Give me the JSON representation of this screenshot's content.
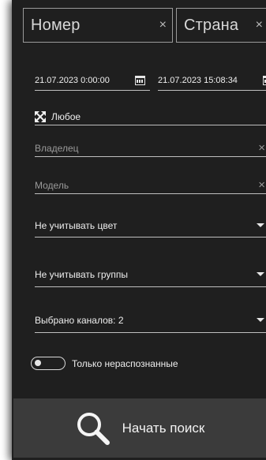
{
  "plate": {
    "placeholder": "Номер",
    "clear": "×"
  },
  "country": {
    "placeholder": "Страна",
    "clear": "×"
  },
  "dates": {
    "from": "21.07.2023 0:00:00",
    "to": "21.07.2023 15:08:34"
  },
  "filters": {
    "direction": "Любое",
    "owner": "Владелец",
    "model": "Модель",
    "color": "Не учитывать цвет",
    "group": "Не учитывать группы",
    "channels": "Выбрано каналов: 2",
    "clear": "×"
  },
  "toggle": {
    "label": "Только нераспознанные",
    "on": false
  },
  "search": {
    "label": "Начать поиск"
  }
}
